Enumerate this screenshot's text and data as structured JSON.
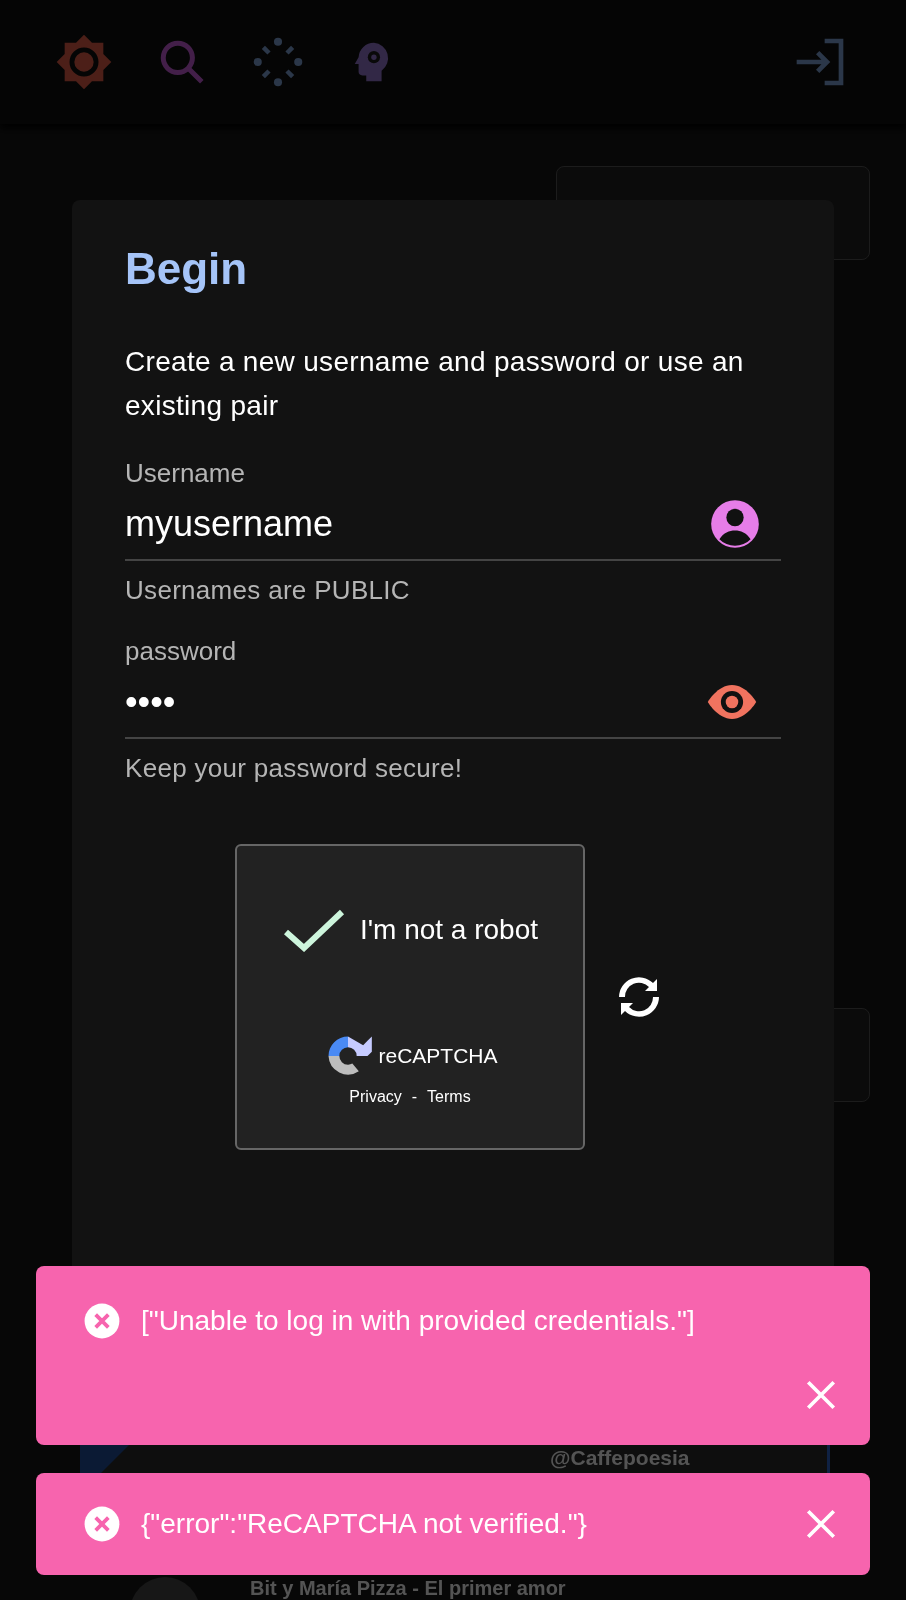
{
  "background": {
    "caption": "@Caffepoesia",
    "video_title": "Bit y María Pizza - El primer amor"
  },
  "dialog": {
    "title": "Begin",
    "intro": "Create a new username and password or use an existing pair",
    "fields": [
      {
        "kind": "user",
        "label": "Username",
        "value": "myusername",
        "helper": "Usernames are PUBLIC"
      },
      {
        "kind": "password",
        "label": "password",
        "value": "••••",
        "helper": "Keep your password secure!"
      }
    ],
    "captcha": {
      "label": "I'm not a robot",
      "checked": true,
      "brand": "reCAPTCHA",
      "links": [
        "Privacy",
        "Terms"
      ],
      "separator": "-"
    }
  },
  "snackbars": [
    {
      "message": "[\"Unable to log in with provided credentials.\"]"
    },
    {
      "message": "{\"error\":\"ReCAPTCHA not verified.\"}"
    }
  ]
}
